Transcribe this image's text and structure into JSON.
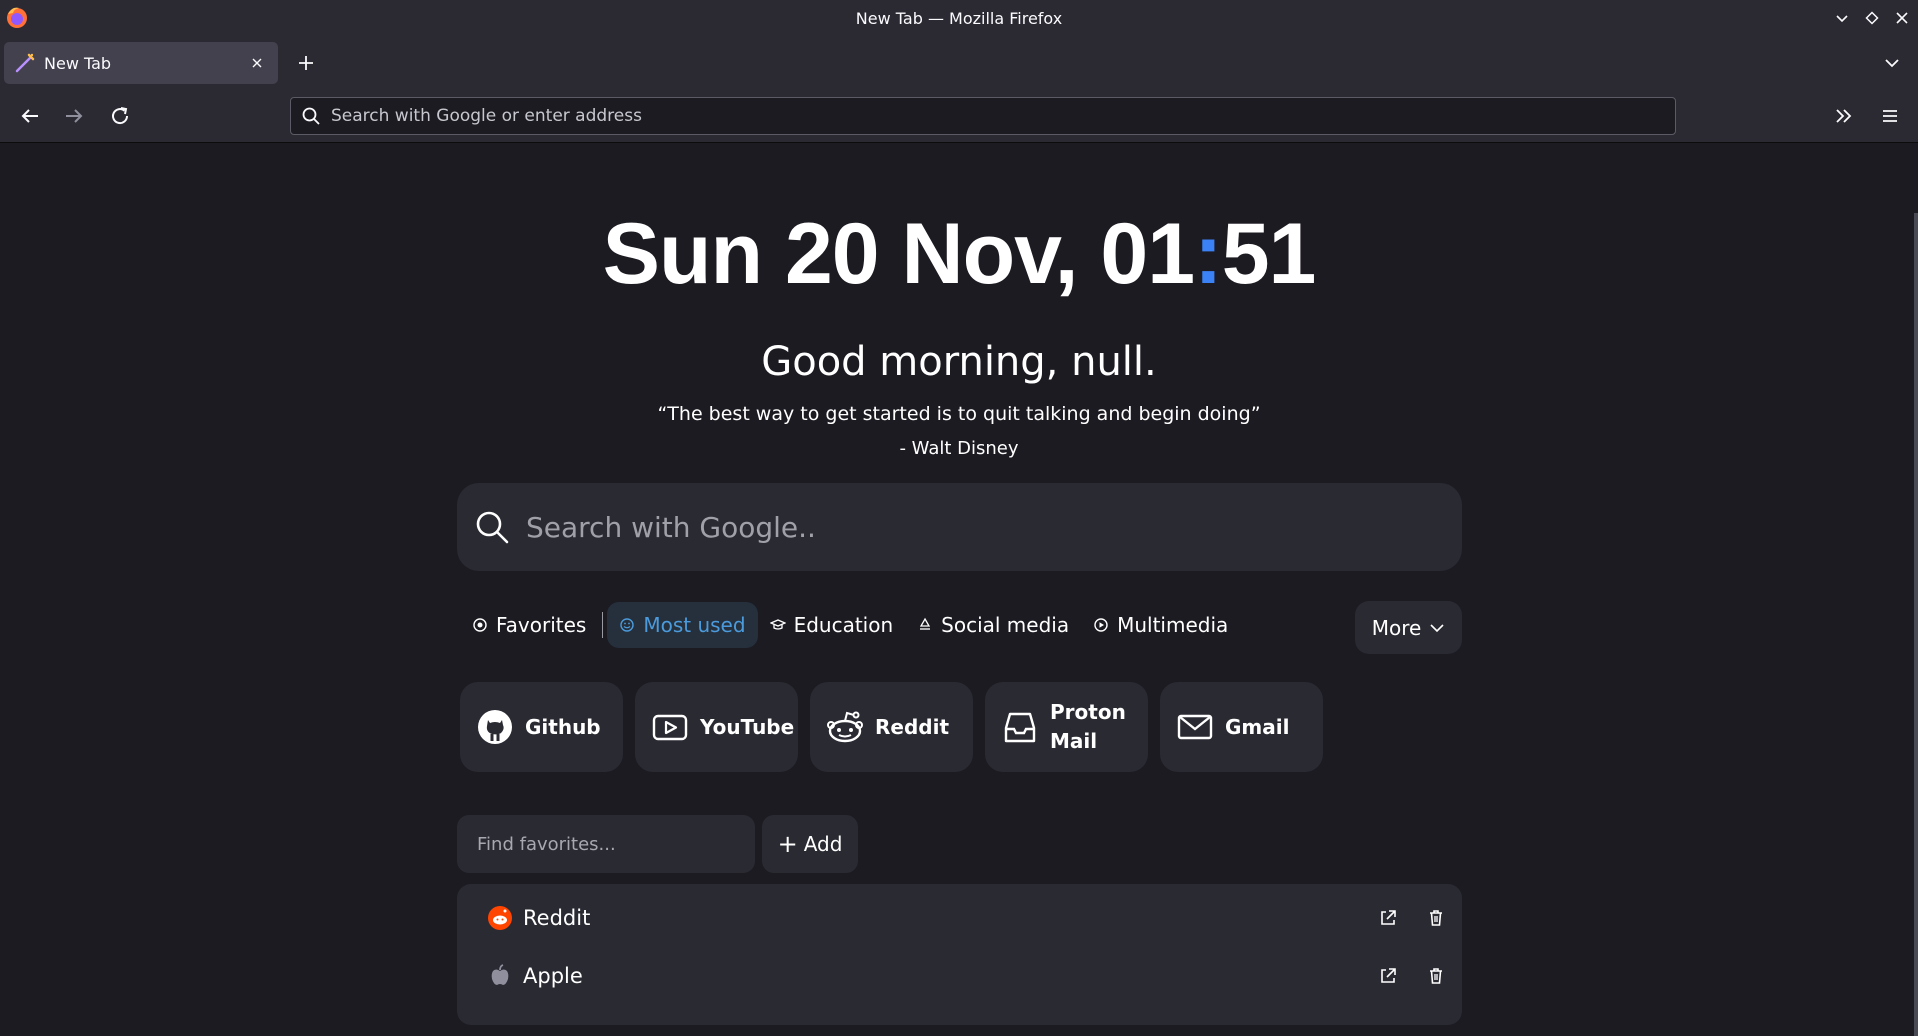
{
  "window": {
    "title": "New Tab — Mozilla Firefox"
  },
  "tabs": [
    {
      "label": "New Tab",
      "active": true
    }
  ],
  "urlbar": {
    "placeholder": "Search with Google or enter address"
  },
  "page": {
    "clock": {
      "date": "Sun 20 Nov, ",
      "hours": "01",
      "separator": ":",
      "minutes": "51"
    },
    "greeting": "Good morning, null.",
    "quote": "“The best way to get started is to quit talking and begin doing”",
    "author": "- Walt Disney",
    "search_placeholder": "Search with Google..",
    "categories": [
      {
        "label": "Favorites",
        "icon": "target-icon",
        "active": false
      },
      {
        "label": "Most used",
        "icon": "smile-icon",
        "active": true
      },
      {
        "label": "Education",
        "icon": "graduation-cap-icon",
        "active": false
      },
      {
        "label": "Social media",
        "icon": "recycle-icon",
        "active": false
      },
      {
        "label": "Multimedia",
        "icon": "play-circle-icon",
        "active": false
      }
    ],
    "more_label": "More",
    "tiles": [
      {
        "label": "Github",
        "icon": "github-icon"
      },
      {
        "label": "YouTube",
        "icon": "youtube-icon"
      },
      {
        "label": "Reddit",
        "icon": "reddit-icon"
      },
      {
        "label": "Proton Mail",
        "icon": "inbox-icon"
      },
      {
        "label": "Gmail",
        "icon": "mail-icon"
      }
    ],
    "find_placeholder": "Find favorites...",
    "add_label": "Add",
    "favorites": [
      {
        "label": "Reddit",
        "icon": "reddit-icon"
      },
      {
        "label": "Apple",
        "icon": "apple-icon"
      }
    ]
  },
  "colors": {
    "accent": "#3b82f6",
    "active_category": "#4b9bdc",
    "background": "#1c1b22",
    "chrome": "#2b2a33",
    "card": "#2a2a33"
  }
}
